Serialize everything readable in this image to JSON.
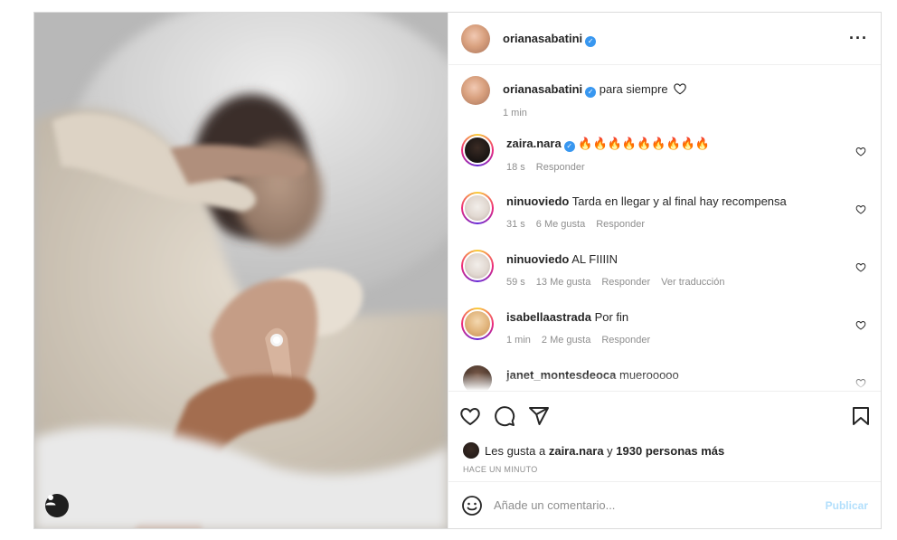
{
  "post": {
    "author": "orianasabatini",
    "caption": {
      "username": "orianasabatini",
      "text": "para siempre",
      "time": "1 min"
    },
    "comments": [
      {
        "username": "zaira.nara",
        "verified": true,
        "text": "🔥🔥🔥🔥🔥🔥🔥🔥🔥",
        "time": "18 s",
        "likes": "",
        "actions": [
          "Responder"
        ]
      },
      {
        "username": "ninuoviedo",
        "verified": false,
        "text": "Tarda en llegar y al final hay recompensa",
        "time": "31 s",
        "likes": "6 Me gusta",
        "actions": [
          "Responder"
        ]
      },
      {
        "username": "ninuoviedo",
        "verified": false,
        "text": "AL FIIIIN",
        "time": "59 s",
        "likes": "13 Me gusta",
        "actions": [
          "Responder",
          "Ver traducción"
        ]
      },
      {
        "username": "isabellaastrada",
        "verified": false,
        "text": "Por fin",
        "time": "1 min",
        "likes": "2 Me gusta",
        "actions": [
          "Responder"
        ]
      },
      {
        "username": "janet_montesdeoca",
        "verified": false,
        "text": "muerooooo",
        "time": "",
        "likes": "",
        "actions": []
      }
    ],
    "likes": {
      "prefix": "Les gusta a",
      "liker": "zaira.nara",
      "connector": "y",
      "others": "1930 personas más"
    },
    "timestamp": "HACE UN MINUTO",
    "add_comment": {
      "placeholder": "Añade un comentario...",
      "publish_label": "Publicar"
    }
  },
  "icons": [
    "more-options-icon",
    "heart-icon",
    "comment-icon",
    "share-icon",
    "bookmark-icon",
    "emoji-icon",
    "user-tag-icon",
    "verified-icon"
  ],
  "colors": {
    "verified": "#3897f0",
    "publish_disabled": "#b2dffc",
    "muted": "#8e8e8e"
  }
}
